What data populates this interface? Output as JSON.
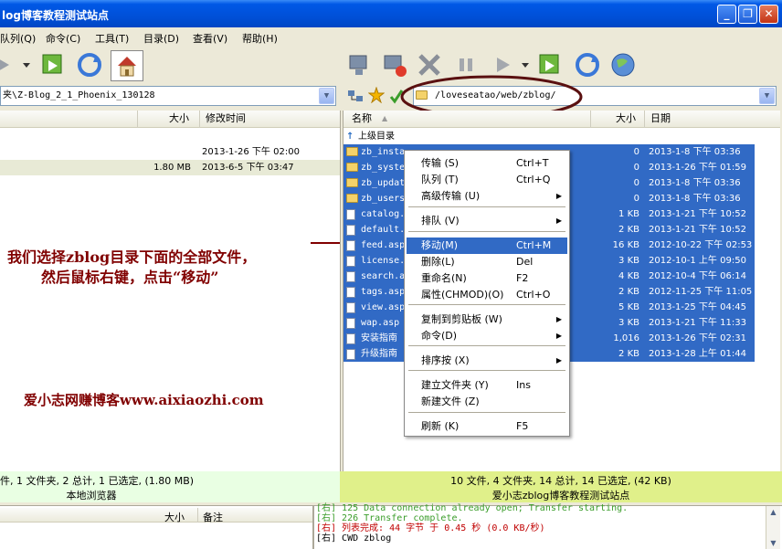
{
  "window": {
    "title": "log博客教程测试站点"
  },
  "menubar": {
    "items": [
      "队列(Q)",
      "命令(C)",
      "工具(T)",
      "目录(D)",
      "查看(V)",
      "帮助(H)"
    ]
  },
  "left": {
    "path": "夹\\Z-Blog_2_1_Phoenix_130128",
    "columns": {
      "size": "大小",
      "modified": "修改时间"
    },
    "rows": [
      {
        "size": "",
        "modified": "2013-1-26 下午 02:00"
      },
      {
        "size": "1.80 MB",
        "modified": "2013-6-5 下午 03:47"
      }
    ],
    "status": "件, 1 文件夹, 2 总计, 1 已选定, (1.80 MB)",
    "status2": "本地浏览器"
  },
  "right": {
    "path": "/loveseatao/web/zblog/",
    "columns": {
      "name": "名称",
      "size": "大小",
      "date": "日期"
    },
    "parent": "上级目录",
    "rows": [
      {
        "name": "zb_insta",
        "size": "0",
        "date": "2013-1-8 下午 03:36",
        "folder": true
      },
      {
        "name": "zb_syste",
        "size": "0",
        "date": "2013-1-26 下午 01:59",
        "folder": true
      },
      {
        "name": "zb_updat",
        "size": "0",
        "date": "2013-1-8 下午 03:36",
        "folder": true
      },
      {
        "name": "zb_users",
        "size": "0",
        "date": "2013-1-8 下午 03:36",
        "folder": true
      },
      {
        "name": "catalog.",
        "size": "1 KB",
        "date": "2013-1-21 下午 10:52",
        "folder": false
      },
      {
        "name": "default.",
        "size": "2 KB",
        "date": "2013-1-21 下午 10:52",
        "folder": false
      },
      {
        "name": "feed.asp",
        "size": "16 KB",
        "date": "2012-10-22 下午 02:53",
        "folder": false
      },
      {
        "name": "license.",
        "size": "3 KB",
        "date": "2012-10-1 上午 09:50",
        "folder": false
      },
      {
        "name": "search.a",
        "size": "4 KB",
        "date": "2012-10-4 下午 06:14",
        "folder": false
      },
      {
        "name": "tags.asp",
        "size": "2 KB",
        "date": "2012-11-25 下午 11:05",
        "folder": false
      },
      {
        "name": "view.asp",
        "size": "5 KB",
        "date": "2013-1-25 下午 04:45",
        "folder": false
      },
      {
        "name": "wap.asp",
        "size": "3 KB",
        "date": "2013-1-21 下午 11:33",
        "folder": false
      },
      {
        "name": "安装指南",
        "size": "1,016",
        "date": "2013-1-26 下午 02:31",
        "folder": false
      },
      {
        "name": "升级指南",
        "size": "2 KB",
        "date": "2013-1-28 上午 01:44",
        "folder": false
      }
    ],
    "status": "10 文件, 4 文件夹, 14 总计, 14 已选定, (42 KB)",
    "status2": "爱小志zblog博客教程测试站点"
  },
  "context_menu": [
    {
      "label": "传输 (S)",
      "key": "Ctrl+T"
    },
    {
      "label": "队列 (T)",
      "key": "Ctrl+Q"
    },
    {
      "label": "高级传输 (U)",
      "key": "",
      "sub": true
    },
    {
      "label": "排队 (V)",
      "key": "",
      "sub": true
    },
    {
      "label": "移动(M)",
      "key": "Ctrl+M"
    },
    {
      "label": "删除(L)",
      "key": "Del"
    },
    {
      "label": "重命名(N)",
      "key": "F2"
    },
    {
      "label": "属性(CHMOD)(O)",
      "key": "Ctrl+O"
    },
    {
      "label": "复制到剪贴板 (W)",
      "key": "",
      "sub": true
    },
    {
      "label": "命令(D)",
      "key": "",
      "sub": true
    },
    {
      "label": "排序按 (X)",
      "key": "",
      "sub": true
    },
    {
      "label": "建立文件夹 (Y)",
      "key": "Ins"
    },
    {
      "label": "新建文件 (Z)",
      "key": ""
    },
    {
      "label": "刷新 (K)",
      "key": "F5"
    }
  ],
  "annotation": {
    "line1": "我们选择zblog目录下面的全部文件，",
    "line2": "然后鼠标右键，点击“移动”",
    "site": "爱小志网赚博客www.aixiaozhi.com"
  },
  "queue": {
    "size": "大小",
    "note": "备注"
  },
  "log": [
    "[右] 125 Data connection already open; Transfer starting.",
    "[右] 226 Transfer complete.",
    "[右] 列表完成: 44 字节 于 0.45 秒 (0.0 KB/秒)",
    "[右] CWD zblog"
  ],
  "colors": {
    "selection": "#316ac5",
    "status_right": "#e0f08a",
    "status_left": "#e9ffe3",
    "annotation": "#800000"
  }
}
